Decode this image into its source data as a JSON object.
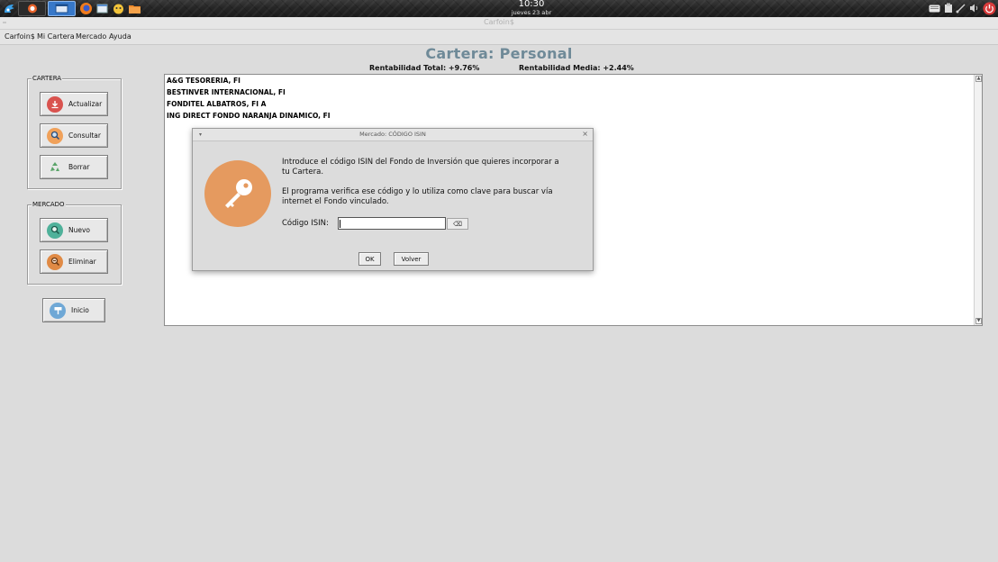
{
  "panel": {
    "time": "10:30",
    "date": "jueves 23 abr"
  },
  "window": {
    "title": "Carfoin$"
  },
  "menubar": {
    "items": [
      "Carfoin$",
      "Mi Cartera",
      "Mercado",
      "Ayuda"
    ]
  },
  "header": {
    "title": "Cartera: Personal",
    "rentabilidad_total": "Rentabilidad Total: +9.76%",
    "rentabilidad_media": "Rentabilidad Media: +2.44%"
  },
  "sidebar": {
    "cartera_group": {
      "legend": "CARTERA",
      "buttons": [
        "Actualizar",
        "Consultar",
        "Borrar"
      ]
    },
    "mercado_group": {
      "legend": "MERCADO",
      "buttons": [
        "Nuevo",
        "Eliminar"
      ]
    },
    "inicio_button": "Inicio"
  },
  "funds": [
    "A&G TESORERIA, FI",
    "BESTINVER INTERNACIONAL, FI",
    "FONDITEL ALBATROS, FI A",
    "ING DIRECT FONDO NARANJA DINAMICO, FI"
  ],
  "dialog": {
    "title": "Mercado: CÓDIGO ISIN",
    "paragraph1_line1": "Introduce el código ISIN del Fondo de Inversión que quieres incorporar a",
    "paragraph1_line2": "tu Cartera.",
    "paragraph2_line1": "El programa verifica ese código y lo utiliza como clave para buscar vía",
    "paragraph2_line2": "internet el Fondo vinculado.",
    "isin_label": "Código ISIN:",
    "isin_value": "",
    "ok_label": "OK",
    "volver_label": "Volver"
  },
  "colors": {
    "title_color": "#6f8a98",
    "key_icon_bg": "#e59a5f",
    "actualizar_icon": "#d9534f",
    "consultar_icon": "#f0a15a",
    "borrar_icon": "#5aa469",
    "nuevo_icon": "#4fb19a",
    "eliminar_icon": "#e08a45",
    "inicio_icon": "#6fa8d6"
  }
}
